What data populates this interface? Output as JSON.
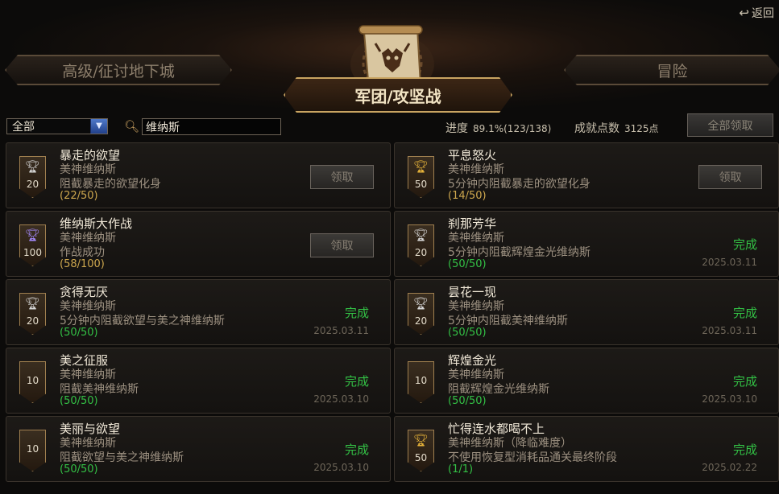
{
  "header": {
    "back_label": "返回",
    "tab_left": "高级/征讨地下城",
    "tab_active": "军团/攻坚战",
    "tab_right": "冒险"
  },
  "toolbar": {
    "filter_value": "全部",
    "search_value": "维纳斯",
    "progress_label": "进度",
    "progress_value": "89.1%(123/138)",
    "points_label": "成就点数",
    "points_value": "3125点",
    "claim_all_label": "全部领取"
  },
  "achievements": [
    {
      "title": "暴走的欲望",
      "subtitle": "美神维纳斯",
      "desc": "阻截暴走的欲望化身",
      "progress": "(22/50)",
      "points": "20",
      "trophy": "silver",
      "status": "claim",
      "claim_label": "领取"
    },
    {
      "title": "平息怒火",
      "subtitle": "美神维纳斯",
      "desc": "5分钟内阻截暴走的欲望化身",
      "progress": "(14/50)",
      "points": "50",
      "trophy": "gold",
      "status": "claim",
      "claim_label": "领取"
    },
    {
      "title": "维纳斯大作战",
      "subtitle": "美神维纳斯",
      "desc": "作战成功",
      "progress": "(58/100)",
      "points": "100",
      "trophy": "purple",
      "status": "claim",
      "claim_label": "领取"
    },
    {
      "title": "刹那芳华",
      "subtitle": "美神维纳斯",
      "desc": "5分钟内阻截辉煌金光维纳斯",
      "progress": "(50/50)",
      "points": "20",
      "trophy": "silver",
      "status": "done",
      "done_label": "完成",
      "date": "2025.03.11"
    },
    {
      "title": "贪得无厌",
      "subtitle": "美神维纳斯",
      "desc": "5分钟内阻截欲望与美之神维纳斯",
      "progress": "(50/50)",
      "points": "20",
      "trophy": "silver",
      "status": "done",
      "done_label": "完成",
      "date": "2025.03.11"
    },
    {
      "title": "昙花一现",
      "subtitle": "美神维纳斯",
      "desc": "5分钟内阻截美神维纳斯",
      "progress": "(50/50)",
      "points": "20",
      "trophy": "silver",
      "status": "done",
      "done_label": "完成",
      "date": "2025.03.11"
    },
    {
      "title": "美之征服",
      "subtitle": "美神维纳斯",
      "desc": "阻截美神维纳斯",
      "progress": "(50/50)",
      "points": "10",
      "trophy": "none",
      "status": "done",
      "done_label": "完成",
      "date": "2025.03.10"
    },
    {
      "title": "辉煌金光",
      "subtitle": "美神维纳斯",
      "desc": "阻截辉煌金光维纳斯",
      "progress": "(50/50)",
      "points": "10",
      "trophy": "none",
      "status": "done",
      "done_label": "完成",
      "date": "2025.03.10"
    },
    {
      "title": "美丽与欲望",
      "subtitle": "美神维纳斯",
      "desc": "阻截欲望与美之神维纳斯",
      "progress": "(50/50)",
      "points": "10",
      "trophy": "none",
      "status": "done",
      "done_label": "完成",
      "date": "2025.03.10"
    },
    {
      "title": "忙得连水都喝不上",
      "subtitle": "美神维纳斯（降临难度）",
      "desc": "不使用恢复型消耗品通关最终阶段",
      "progress": "(1/1)",
      "points": "50",
      "trophy": "gold",
      "status": "done",
      "done_label": "完成",
      "date": "2025.02.22"
    }
  ]
}
